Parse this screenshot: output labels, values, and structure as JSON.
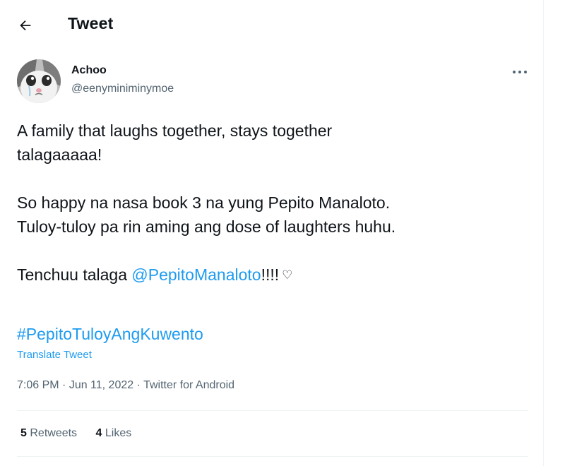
{
  "header": {
    "back_icon": "arrow-left-icon",
    "title": "Tweet"
  },
  "tweet": {
    "author": {
      "display_name": "Achoo",
      "username": "@eenyminiminymoe",
      "avatar_icon": "crying-cat-avatar"
    },
    "more_icon": "more-dots-icon",
    "text": {
      "line1": "A family that laughs together, stays together",
      "line2": "talagaaaaa!",
      "line3": "So happy na nasa book 3 na yung Pepito Manaloto.",
      "line4": "Tuloy-tuloy pa rin aming ang dose of laughters huhu.",
      "line5_prefix": "Tenchuu talaga ",
      "mention": "@PepitoManaloto",
      "line5_suffix": "!!!!",
      "heart": "♡"
    },
    "hashtag": "#PepitoTuloyAngKuwento",
    "translate_label": "Translate Tweet",
    "meta": {
      "time": "7:06 PM",
      "separator": " · ",
      "date": "Jun 11, 2022",
      "source": "Twitter for Android"
    },
    "stats": {
      "retweets_count": "5",
      "retweets_label": "Retweets",
      "likes_count": "4",
      "likes_label": "Likes"
    }
  },
  "colors": {
    "accent": "#1d9bf0",
    "text": "#0f1419",
    "secondary": "#536471",
    "border": "#eff3f4"
  }
}
